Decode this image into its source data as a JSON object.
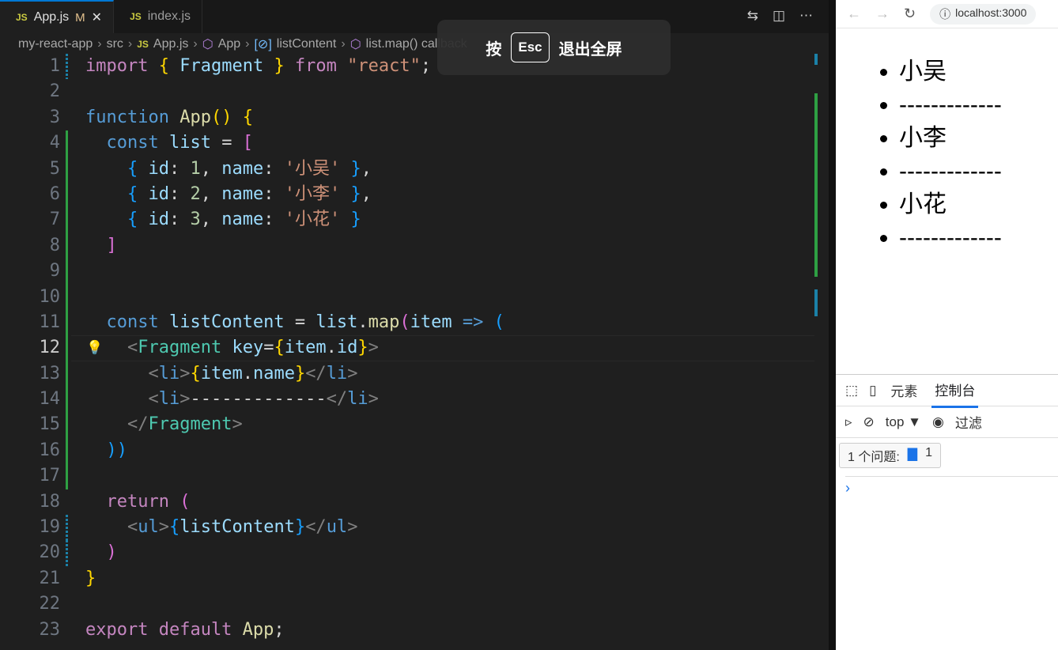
{
  "editor": {
    "tabs": [
      {
        "label": "App.js",
        "badge": "M",
        "active": true
      },
      {
        "label": "index.js",
        "active": false
      }
    ],
    "breadcrumb": [
      "my-react-app",
      "src",
      "App.js",
      "App",
      "listContent",
      "list.map() callback"
    ],
    "current_line": 12,
    "lines": [
      [
        [
          "import",
          "kw"
        ],
        [
          " ",
          "pl"
        ],
        [
          "{",
          "b1"
        ],
        [
          " Fragment ",
          "id"
        ],
        [
          "}",
          "b1"
        ],
        [
          " from ",
          "kw"
        ],
        [
          "\"react\"",
          "str"
        ],
        [
          ";",
          "pl"
        ]
      ],
      [],
      [
        [
          "function",
          "st"
        ],
        [
          " App",
          "fn"
        ],
        [
          "()",
          "b1"
        ],
        [
          " ",
          "pl"
        ],
        [
          "{",
          "b1"
        ]
      ],
      [
        [
          "  const",
          "st"
        ],
        [
          " list",
          "id"
        ],
        [
          " = ",
          "pl"
        ],
        [
          "[",
          "b2"
        ]
      ],
      [
        [
          "    ",
          "pl"
        ],
        [
          "{",
          "b3"
        ],
        [
          " id",
          "id"
        ],
        [
          ": ",
          "pl"
        ],
        [
          "1",
          "num"
        ],
        [
          ", ",
          "pl"
        ],
        [
          "name",
          "id"
        ],
        [
          ": ",
          "pl"
        ],
        [
          "'小吴'",
          "str"
        ],
        [
          " ",
          "pl"
        ],
        [
          "}",
          "b3"
        ],
        [
          ",",
          "pl"
        ]
      ],
      [
        [
          "    ",
          "pl"
        ],
        [
          "{",
          "b3"
        ],
        [
          " id",
          "id"
        ],
        [
          ": ",
          "pl"
        ],
        [
          "2",
          "num"
        ],
        [
          ", ",
          "pl"
        ],
        [
          "name",
          "id"
        ],
        [
          ": ",
          "pl"
        ],
        [
          "'小李'",
          "str"
        ],
        [
          " ",
          "pl"
        ],
        [
          "}",
          "b3"
        ],
        [
          ",",
          "pl"
        ]
      ],
      [
        [
          "    ",
          "pl"
        ],
        [
          "{",
          "b3"
        ],
        [
          " id",
          "id"
        ],
        [
          ": ",
          "pl"
        ],
        [
          "3",
          "num"
        ],
        [
          ", ",
          "pl"
        ],
        [
          "name",
          "id"
        ],
        [
          ": ",
          "pl"
        ],
        [
          "'小花'",
          "str"
        ],
        [
          " ",
          "pl"
        ],
        [
          "}",
          "b3"
        ]
      ],
      [
        [
          "  ",
          "pl"
        ],
        [
          "]",
          "b2"
        ]
      ],
      [],
      [],
      [
        [
          "  const",
          "st"
        ],
        [
          " listContent",
          "id"
        ],
        [
          " = ",
          "pl"
        ],
        [
          "list",
          "id"
        ],
        [
          ".",
          "pl"
        ],
        [
          "map",
          "fn"
        ],
        [
          "(",
          "b2"
        ],
        [
          "item",
          "id"
        ],
        [
          " => ",
          "st"
        ],
        [
          "(",
          "b3"
        ]
      ],
      [
        [
          "    <",
          "tg"
        ],
        [
          "Fragment",
          "tn"
        ],
        [
          " key",
          "id"
        ],
        [
          "=",
          "pl"
        ],
        [
          "{",
          "b1"
        ],
        [
          "item",
          "id"
        ],
        [
          ".",
          "pl"
        ],
        [
          "id",
          "id"
        ],
        [
          "}",
          "b1"
        ],
        [
          ">",
          "tg"
        ]
      ],
      [
        [
          "      <",
          "tg"
        ],
        [
          "li",
          "st"
        ],
        [
          ">",
          "tg"
        ],
        [
          "{",
          "b1"
        ],
        [
          "item",
          "id"
        ],
        [
          ".",
          "pl"
        ],
        [
          "name",
          "id"
        ],
        [
          "}",
          "b1"
        ],
        [
          "</",
          "tg"
        ],
        [
          "li",
          "st"
        ],
        [
          ">",
          "tg"
        ]
      ],
      [
        [
          "      <",
          "tg"
        ],
        [
          "li",
          "st"
        ],
        [
          ">",
          "tg"
        ],
        [
          "-------------",
          "pl"
        ],
        [
          "</",
          "tg"
        ],
        [
          "li",
          "st"
        ],
        [
          ">",
          "tg"
        ]
      ],
      [
        [
          "    </",
          "tg"
        ],
        [
          "Fragment",
          "tn"
        ],
        [
          ">",
          "tg"
        ]
      ],
      [
        [
          "  ",
          "pl"
        ],
        [
          "))",
          "b3"
        ]
      ],
      [],
      [
        [
          "  return",
          "kw"
        ],
        [
          " ",
          "pl"
        ],
        [
          "(",
          "b2"
        ]
      ],
      [
        [
          "    <",
          "tg"
        ],
        [
          "ul",
          "st"
        ],
        [
          ">",
          "tg"
        ],
        [
          "{",
          "b3"
        ],
        [
          "listContent",
          "id"
        ],
        [
          "}",
          "b3"
        ],
        [
          "</",
          "tg"
        ],
        [
          "ul",
          "st"
        ],
        [
          ">",
          "tg"
        ]
      ],
      [
        [
          "  ",
          "pl"
        ],
        [
          ")",
          "b2"
        ]
      ],
      [
        [
          "}",
          "b1"
        ]
      ],
      [],
      [
        [
          "export default",
          "kw"
        ],
        [
          " App",
          "fn"
        ],
        [
          ";",
          "pl"
        ]
      ]
    ]
  },
  "toast": {
    "pre": "按",
    "key": "Esc",
    "post": "退出全屏"
  },
  "browser": {
    "url": "localhost:3000",
    "items": [
      "小吴",
      "-------------",
      "小李",
      "-------------",
      "小花",
      "-------------"
    ],
    "devtools": {
      "tabs": [
        "元素",
        "控制台"
      ],
      "active_tab": "控制台",
      "context": "top ▼",
      "filter": "过滤",
      "issues_label": "1 个问题:",
      "issues_count": "1",
      "prompt": "›"
    }
  },
  "colors": {
    "accent": "#0078d4",
    "devtools_accent": "#1a73e8"
  }
}
